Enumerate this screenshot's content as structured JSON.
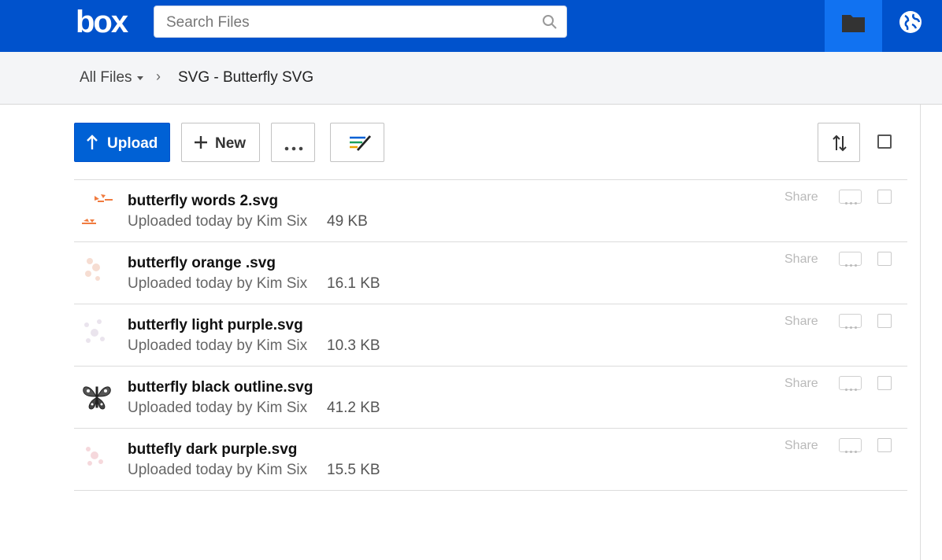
{
  "header": {
    "logo": "box",
    "search": {
      "placeholder": "Search Files",
      "value": ""
    },
    "accent": "#0052cc",
    "active_tab_color": "#1172f1",
    "icons": [
      "search-icon",
      "folder-icon",
      "globe-icon"
    ]
  },
  "breadcrumb": {
    "root": "All Files",
    "separator": "›",
    "current": "SVG - Butterfly SVG"
  },
  "toolbar": {
    "upload_label": "Upload",
    "new_label": "New",
    "upload_color": "#0061d5"
  },
  "files": [
    {
      "name": "butterfly words 2.svg",
      "meta": "Uploaded today by Kim Six",
      "size": "49 KB",
      "share_label": "Share",
      "thumb": "orange-words"
    },
    {
      "name": "butterfly orange .svg",
      "meta": "Uploaded today by Kim Six",
      "size": "16.1 KB",
      "share_label": "Share",
      "thumb": "faint-orange"
    },
    {
      "name": "butterfly light purple.svg",
      "meta": "Uploaded today by Kim Six",
      "size": "10.3 KB",
      "share_label": "Share",
      "thumb": "faint-purple"
    },
    {
      "name": "butterfly black outline.svg",
      "meta": "Uploaded today by Kim Six",
      "size": "41.2 KB",
      "share_label": "Share",
      "thumb": "black-butterfly"
    },
    {
      "name": "buttefly dark purple.svg",
      "meta": "Uploaded today by Kim Six",
      "size": "15.5 KB",
      "share_label": "Share",
      "thumb": "faint-pink"
    }
  ]
}
